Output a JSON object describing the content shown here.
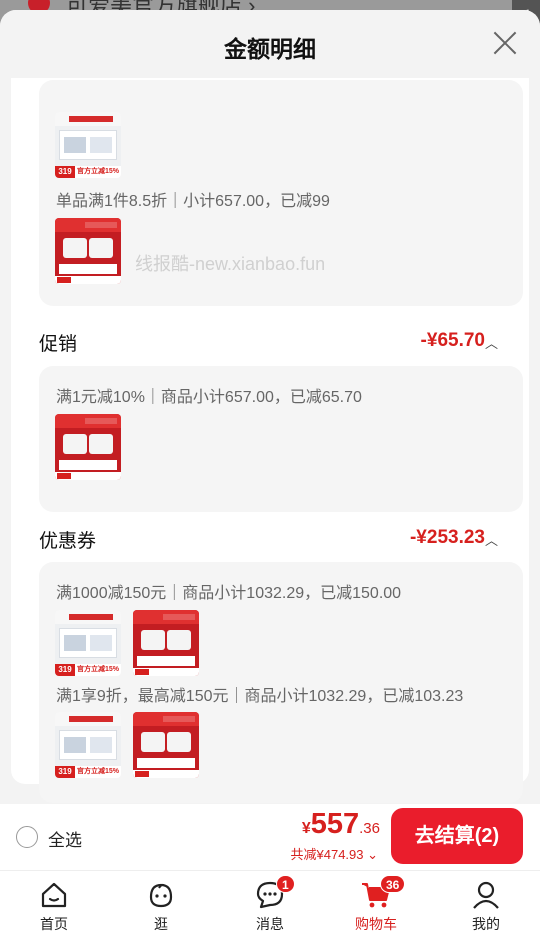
{
  "background": {
    "store_name": "可爱美官方旗舰店 ›"
  },
  "side_tab": {
    "chevron": "‹"
  },
  "sheet": {
    "title": "金额明细"
  },
  "sections": {
    "first": {
      "rule": "单品满1件8.5折｜小计657.00，已减99",
      "thumb_prices": [
        "319",
        "558"
      ],
      "thumb_promo": "官方立减15%"
    },
    "promotion": {
      "label": "促销",
      "amount": "-¥65.70",
      "rule": "满1元减10%｜商品小计657.00，已减65.70",
      "thumb_price": "558"
    },
    "coupon": {
      "label": "优惠券",
      "amount": "-¥253.23",
      "rule1": "满1000减150元｜商品小计1032.29，已减150.00",
      "rule2": "满1享9折，最高减150元｜商品小计1032.29，已减103.23",
      "thumb_prices": [
        "319",
        "558"
      ],
      "thumb_promo": "官方立减15%"
    }
  },
  "watermark": "线报酷-new.xianbao.fun",
  "checkout": {
    "select_all": "全选",
    "currency": "¥",
    "total_int": "557",
    "total_dec": ".36",
    "saved": "共减¥474.93 ⌄",
    "pay_button": "去结算(2)"
  },
  "tabbar": [
    {
      "label": "首页",
      "icon": "home-icon"
    },
    {
      "label": "逛",
      "icon": "stroll-face-icon"
    },
    {
      "label": "消息",
      "icon": "message-icon",
      "badge": "1"
    },
    {
      "label": "购物车",
      "icon": "cart-icon",
      "badge": "36",
      "active": true
    },
    {
      "label": "我的",
      "icon": "profile-icon"
    }
  ],
  "colors": {
    "accent": "#d6201e",
    "button": "#ea1d2c",
    "sheet_bg": "#f3f3f3"
  }
}
